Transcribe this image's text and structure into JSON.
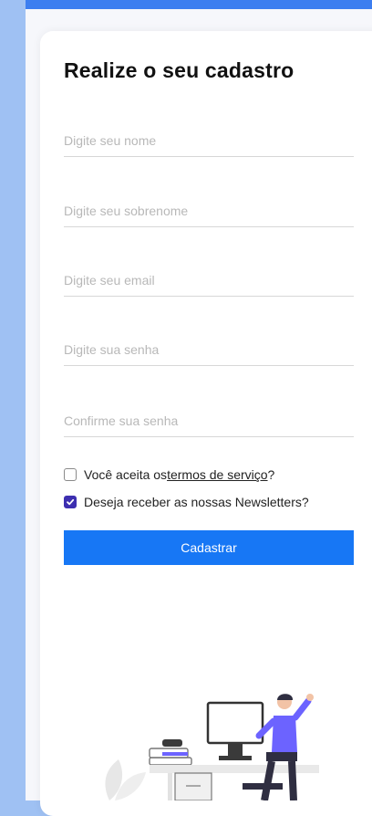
{
  "form": {
    "title": "Realize o seu cadastro",
    "fields": {
      "name_placeholder": "Digite seu nome",
      "surname_placeholder": "Digite seu sobrenome",
      "email_placeholder": "Digite seu email",
      "password_placeholder": "Digite sua senha",
      "confirm_placeholder": "Confirme sua senha"
    },
    "terms": {
      "prefix": "Você aceita os ",
      "link": "termos de serviço",
      "suffix": "?",
      "checked": false
    },
    "newsletter": {
      "label": "Deseja receber as nossas Newsletters?",
      "checked": true
    },
    "submit_label": "Cadastrar"
  },
  "colors": {
    "page_background": "#9fc1f3",
    "button": "#1777f5",
    "checkbox_checked": "#3d2fb0",
    "illustration_accent": "#6c63ff"
  },
  "icons": [
    "checkmark-icon",
    "person-at-desk-illustration"
  ]
}
